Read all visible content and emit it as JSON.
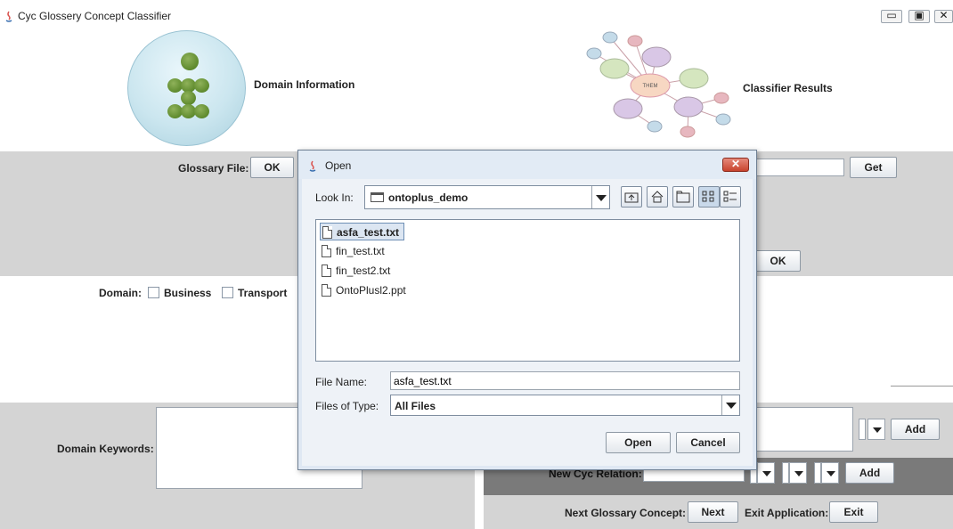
{
  "window": {
    "title": "Cyc Glossery Concept Classifier",
    "minimize_glyph": "▭",
    "maximize_glyph": "▣",
    "close_glyph": "✕"
  },
  "header": {
    "domain_info_label": "Domain Information",
    "classifier_results_label": "Classifier Results",
    "cloud_center_label": "THEM"
  },
  "glossary": {
    "label": "Glossary File:",
    "ok_label": "OK",
    "get_label": "Get",
    "ok2_label": "OK"
  },
  "domain": {
    "label": "Domain:",
    "options": [
      "Business",
      "Transport"
    ]
  },
  "keywords": {
    "label": "Domain Keywords:"
  },
  "relations": {
    "add_label": "Add",
    "new_cyc_relation_label": "New Cyc Relation:",
    "add2_label": "Add"
  },
  "footer": {
    "next_concept_label": "Next Glossary Concept:",
    "next_button": "Next",
    "exit_label": "Exit Application:",
    "exit_button": "Exit"
  },
  "dialog": {
    "title": "Open",
    "close_glyph": "✕",
    "look_in_label": "Look In:",
    "look_in_value": "ontoplus_demo",
    "files": [
      "asfa_test.txt",
      "fin_test.txt",
      "fin_test2.txt",
      "OntoPlusl2.ppt"
    ],
    "selected_file": "asfa_test.txt",
    "file_name_label": "File Name:",
    "file_name_value": "asfa_test.txt",
    "files_of_type_label": "Files of Type:",
    "files_of_type_value": "All Files",
    "open_button": "Open",
    "cancel_button": "Cancel"
  },
  "colors": {
    "panel_grey": "#d4d4d4",
    "dark_grey": "#7a7a7a",
    "dialog_bg": "#eef2f7",
    "close_red": "#c8432d"
  }
}
